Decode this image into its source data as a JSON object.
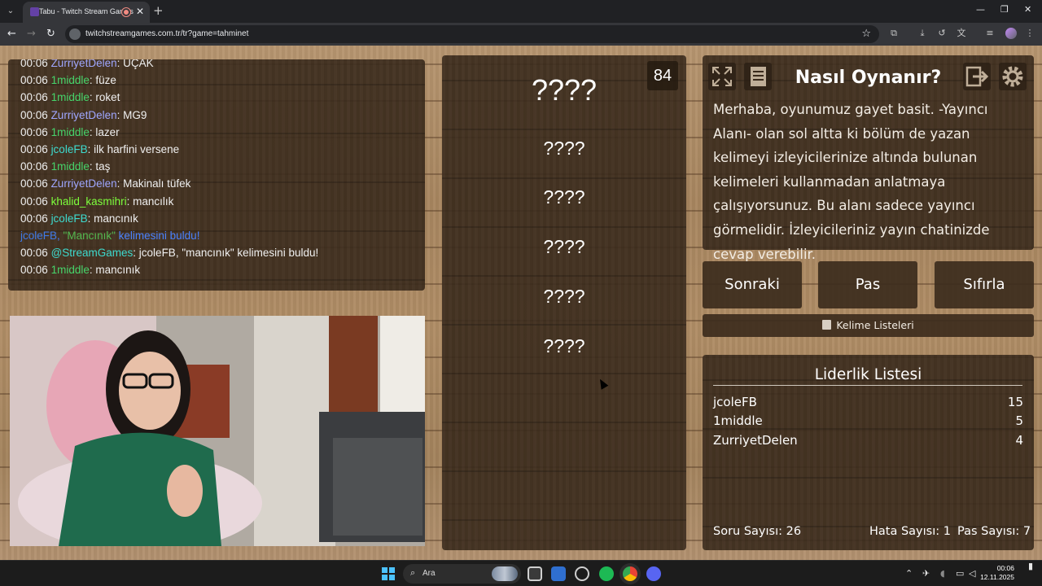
{
  "browser": {
    "tab_title": "Tabu - Twitch Stream Games",
    "url": "twitchstreamgames.com.tr/tr?game=tahminet",
    "colors": {
      "tabbar": "#202124",
      "toolbar": "#35363a"
    }
  },
  "chat": {
    "lines": [
      {
        "time": "00:06",
        "user": "ZurriyetDelen",
        "user_color": "#9fa7ff",
        "msg": ": UÇAK"
      },
      {
        "time": "00:06",
        "user": "1middle",
        "user_color": "#46d46a",
        "msg": ": füze"
      },
      {
        "time": "00:06",
        "user": "1middle",
        "user_color": "#46d46a",
        "msg": ": roket"
      },
      {
        "time": "00:06",
        "user": "ZurriyetDelen",
        "user_color": "#9fa7ff",
        "msg": ": MG9"
      },
      {
        "time": "00:06",
        "user": "1middle",
        "user_color": "#46d46a",
        "msg": ": lazer"
      },
      {
        "time": "00:06",
        "user": "jcoleFB",
        "user_color": "#3ddbcf",
        "msg": ": ilk harfini versene"
      },
      {
        "time": "00:06",
        "user": "1middle",
        "user_color": "#46d46a",
        "msg": ": taş"
      },
      {
        "time": "00:06",
        "user": "ZurriyetDelen",
        "user_color": "#9fa7ff",
        "msg": ": Makinalı tüfek"
      },
      {
        "time": "00:06",
        "user": "khalid_kasmihri",
        "user_color": "#7dff3c",
        "msg": ": mancılık"
      },
      {
        "time": "00:06",
        "user": "jcoleFB",
        "user_color": "#3ddbcf",
        "msg": ": mancınık"
      },
      {
        "notice": true,
        "user": "jcoleFB",
        "pre": ", ",
        "word": "\"Mancınık\"",
        "post": " kelimesini buldu!"
      },
      {
        "time": "00:06",
        "user": "@StreamGames",
        "user_color": "#3ddbcf",
        "msg": ": jcoleFB, \"mancınık\" kelimesini buldu!"
      },
      {
        "time": "00:06",
        "user": "1middle",
        "user_color": "#46d46a",
        "msg": ": mancınık"
      }
    ]
  },
  "words": {
    "timer": "84",
    "main": "????",
    "items": [
      "????",
      "????",
      "????",
      "????",
      "????"
    ]
  },
  "howto": {
    "title": "Nasıl Oynanır?",
    "text": "Merhaba, oyunumuz gayet basit. -Yayıncı Alanı- olan sol altta ki bölüm de yazan kelimeyi izleyicilerinize altında bulunan kelimeleri kullanmadan anlatmaya çalışıyorsunuz. Bu alanı sadece yayıncı görmelidir. İzleyicileriniz yayın chatinizde cevap verebilir.",
    "icons": [
      "fullscreen-icon",
      "notes-icon",
      "logout-icon",
      "settings-icon"
    ]
  },
  "controls": {
    "next": "Sonraki",
    "pass": "Pas",
    "reset": "Sıfırla",
    "word_lists": "Kelime Listeleri"
  },
  "leaderboard": {
    "title": "Liderlik Listesi",
    "rows": [
      {
        "name": "jcoleFB",
        "score": "15"
      },
      {
        "name": "1middle",
        "score": "5"
      },
      {
        "name": "ZurriyetDelen",
        "score": "4"
      }
    ],
    "stats": {
      "questions": "Soru Sayısı: 26",
      "errors": "Hata Sayısı: 1",
      "passes": "Pas Sayısı: 7"
    }
  },
  "taskbar": {
    "search_placeholder": "Ara",
    "time": "00:06",
    "date": "12.11.2025"
  }
}
